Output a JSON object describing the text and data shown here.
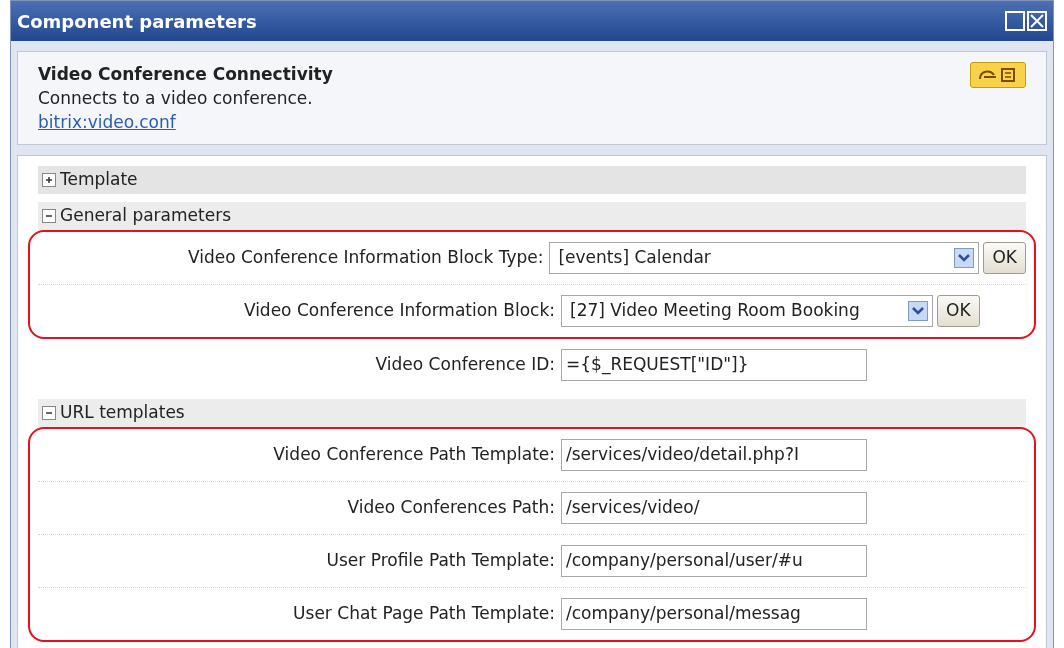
{
  "window": {
    "title": "Component parameters"
  },
  "component": {
    "name": "Video Conference Connectivity",
    "description": "Connects to a video conference.",
    "link": "bitrix:video.conf"
  },
  "sections": [
    {
      "title": "Template",
      "expanded": false
    },
    {
      "title": "General parameters",
      "expanded": true,
      "groups": [
        {
          "highlighted": true,
          "fields": [
            {
              "kind": "select",
              "label": "Video Conference Information Block Type:",
              "value": "[events] Calendar",
              "button": "OK",
              "wide": true
            },
            {
              "kind": "select",
              "label": "Video Conference Information Block:",
              "value": "[27] Video Meeting Room Booking",
              "button": "OK",
              "wide": false
            }
          ]
        },
        {
          "highlighted": false,
          "fields": [
            {
              "kind": "text",
              "label": "Video Conference ID:",
              "value": "={$_REQUEST[\"ID\"]}"
            }
          ]
        }
      ]
    },
    {
      "title": "URL templates",
      "expanded": true,
      "groups": [
        {
          "highlighted": true,
          "fields": [
            {
              "kind": "text",
              "label": "Video Conference Path Template:",
              "value": "/services/video/detail.php?I"
            },
            {
              "kind": "text",
              "label": "Video Conferences Path:",
              "value": "/services/video/"
            },
            {
              "kind": "text",
              "label": "User Profile Path Template:",
              "value": "/company/personal/user/#u"
            },
            {
              "kind": "text",
              "label": "User Chat Page Path Template:",
              "value": "/company/personal/messag"
            }
          ]
        }
      ]
    }
  ]
}
